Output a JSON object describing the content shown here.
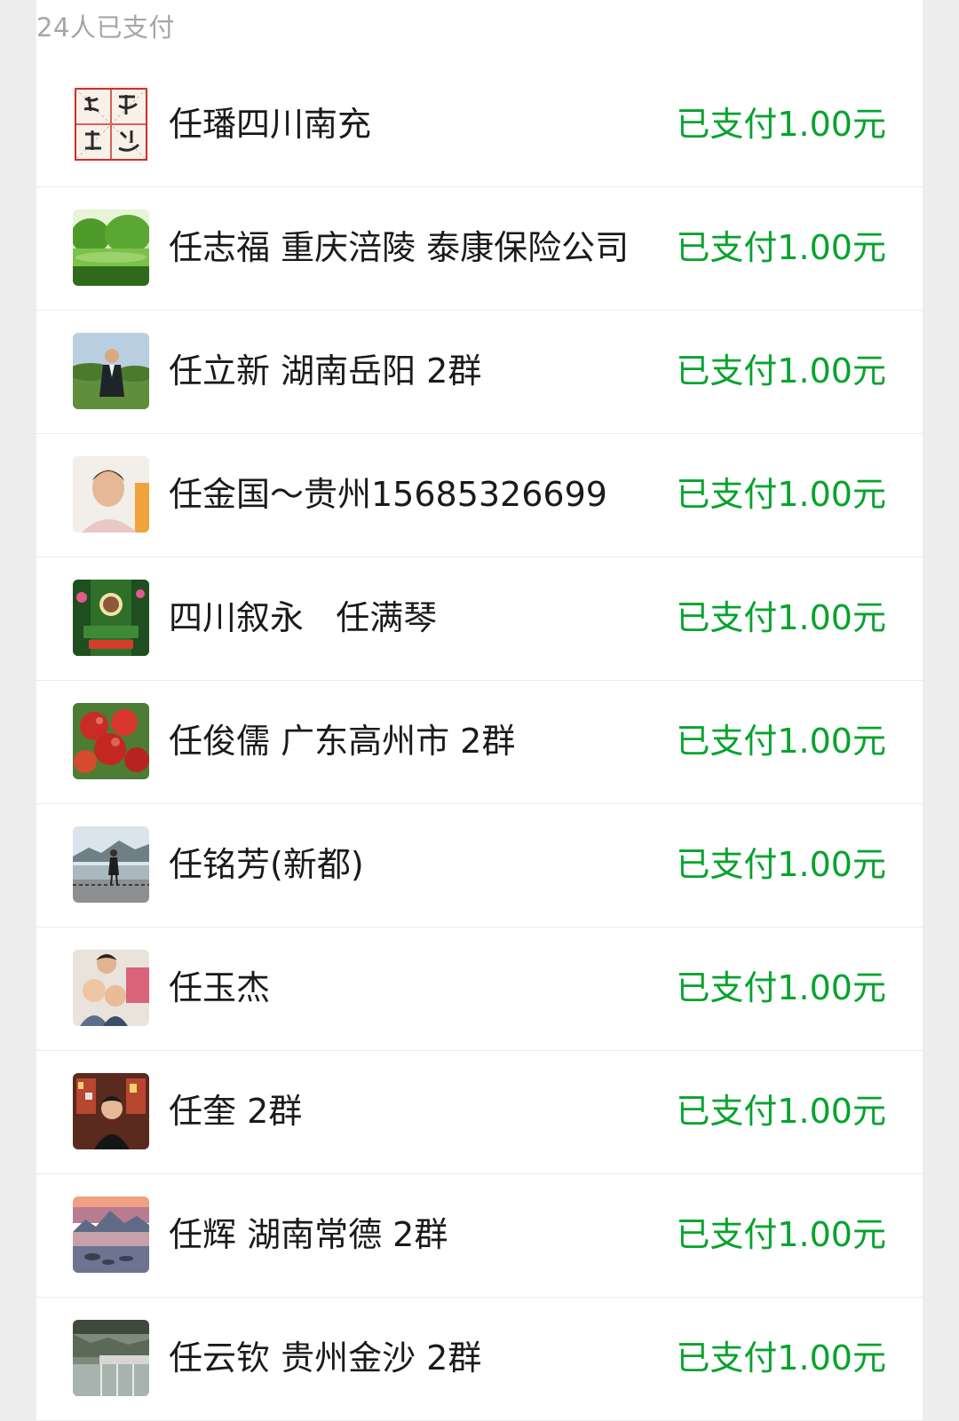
{
  "header": {
    "paid_count_label": "24人已支付"
  },
  "colors": {
    "status_green": "#07a32e",
    "name_text": "#1a1a1a",
    "header_text": "#a6a6a6"
  },
  "payers": [
    {
      "name": "任璠四川南充",
      "status": "已支付1.00元",
      "avatar": "calligraphy-avatar"
    },
    {
      "name": "任志福 重庆涪陵 泰康保险公司",
      "status": "已支付1.00元",
      "avatar": "green-lake-avatar"
    },
    {
      "name": "任立新 湖南岳阳 2群",
      "status": "已支付1.00元",
      "avatar": "man-in-field-avatar"
    },
    {
      "name": "任金国～贵州15685326699",
      "status": "已支付1.00元",
      "avatar": "portrait-avatar"
    },
    {
      "name": "四川叙永   任满琴",
      "status": "已支付1.00元",
      "avatar": "garden-poster-avatar"
    },
    {
      "name": "任俊儒 广东高州市 2群",
      "status": "已支付1.00元",
      "avatar": "apples-avatar"
    },
    {
      "name": "任铭芳(新都)",
      "status": "已支付1.00元",
      "avatar": "riverside-avatar"
    },
    {
      "name": "任玉杰",
      "status": "已支付1.00元",
      "avatar": "family-photo-avatar"
    },
    {
      "name": "任奎 2群",
      "status": "已支付1.00元",
      "avatar": "shop-avatar"
    },
    {
      "name": "任辉 湖南常德 2群",
      "status": "已支付1.00元",
      "avatar": "sunset-lake-avatar"
    },
    {
      "name": "任云钦 贵州金沙 2群",
      "status": "已支付1.00元",
      "avatar": "dam-avatar"
    }
  ]
}
